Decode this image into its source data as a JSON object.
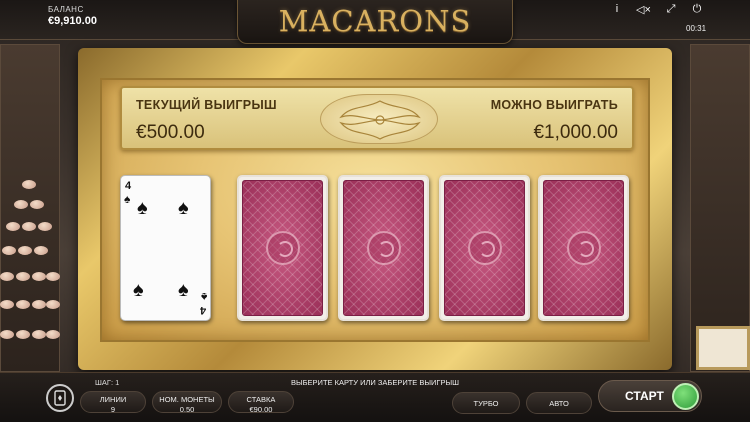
{
  "header": {
    "balance_label": "БАЛАНС",
    "balance_value": "€9,910.00",
    "title": "MACARONS",
    "icons": [
      "info-icon",
      "sound-off-icon",
      "fullscreen-icon",
      "power-icon"
    ],
    "clock": "00:31"
  },
  "gamble": {
    "current_win_label": "ТЕКУЩИЙ ВЫИГРЫШ",
    "current_win_value": "€500.00",
    "possible_win_label": "МОЖНО ВЫИГРАТЬ",
    "possible_win_value": "€1,000.00",
    "dealer_card": {
      "rank": "4",
      "suit": "♠"
    },
    "hidden_cards": 4
  },
  "footer": {
    "step": "ШАГ: 1",
    "hint": "ВЫБЕРИТЕ КАРТУ ИЛИ ЗАБЕРИТЕ ВЫИГРЫШ",
    "lines_label": "ЛИНИИ",
    "lines_value": "9",
    "coin_label": "НОМ. МОНЕТЫ",
    "coin_value": "0.50",
    "bet_label": "СТАВКА",
    "bet_value": "€90.00",
    "turbo_label": "ТУРБО",
    "auto_label": "АВТО",
    "start_label": "СТАРТ"
  },
  "colors": {
    "gold": "#d9b160",
    "card_back": "#b0406a",
    "start_green": "#2f9c3a"
  }
}
